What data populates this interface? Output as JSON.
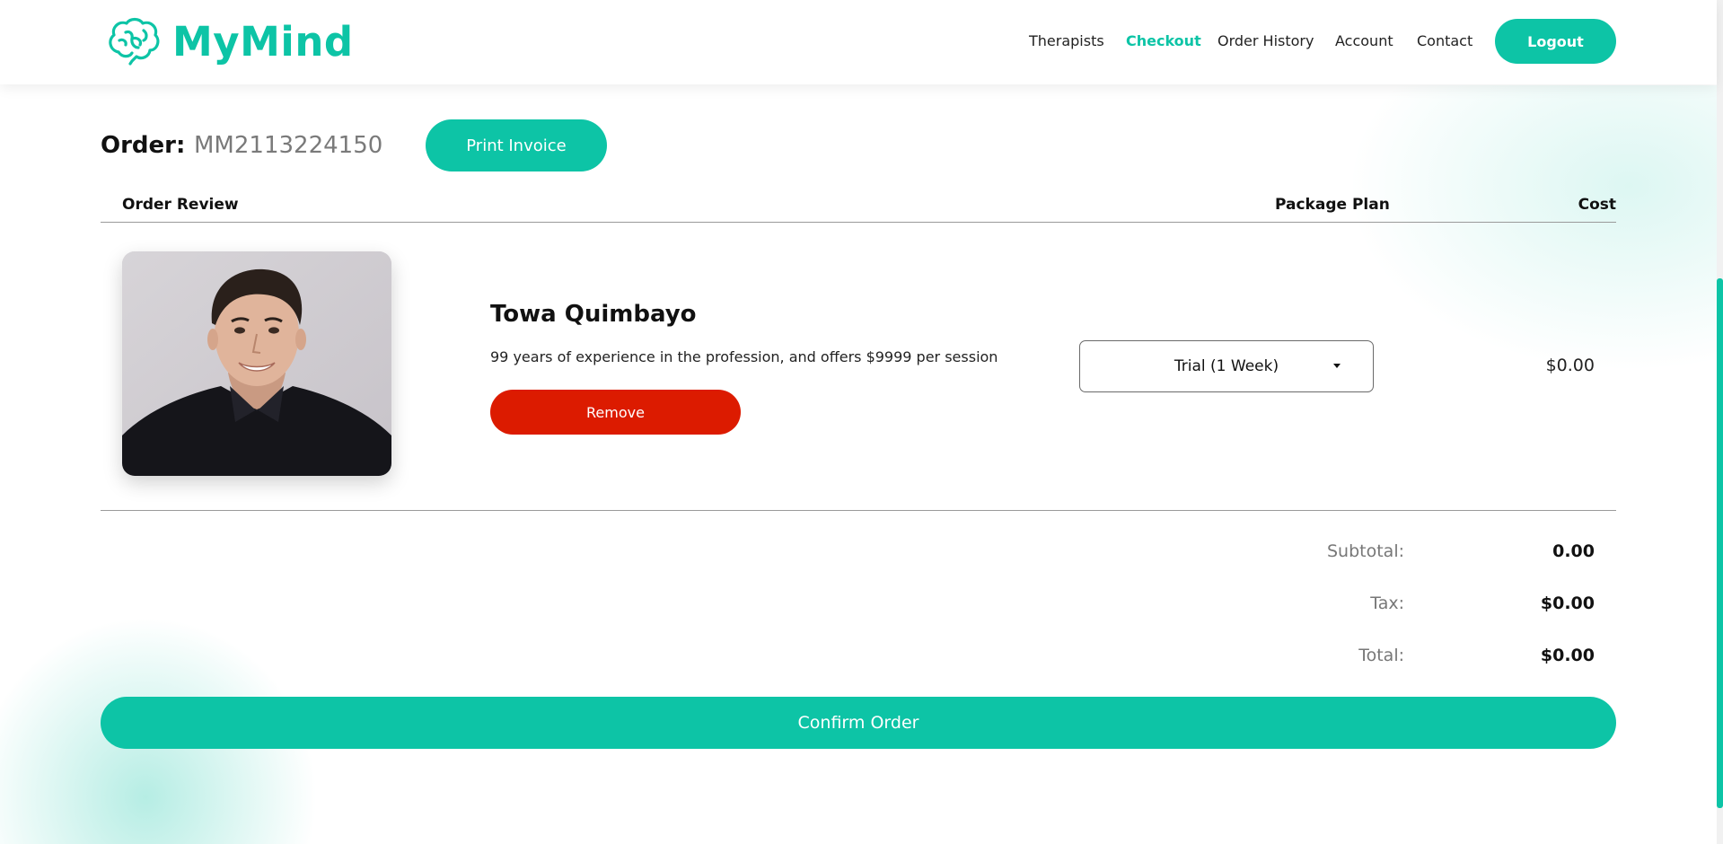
{
  "app": {
    "brand": "MyMind",
    "accent_color": "#0dc4a6",
    "danger_color": "#dc1b00"
  },
  "nav": {
    "items": [
      {
        "label": "Therapists",
        "active": false
      },
      {
        "label": "Checkout",
        "active": true
      },
      {
        "label": "Order History",
        "active": false
      },
      {
        "label": "Account",
        "active": false
      },
      {
        "label": "Contact",
        "active": false
      }
    ],
    "logout_label": "Logout"
  },
  "order": {
    "label": "Order:",
    "id": "MM2113224150",
    "print_label": "Print Invoice"
  },
  "table": {
    "headers": {
      "review": "Order Review",
      "plan": "Package Plan",
      "cost": "Cost"
    }
  },
  "item": {
    "photo_icon": "therapist-photo",
    "name": "Towa Quimbayo",
    "description": "99 years of experience in the profession, and offers $9999 per session",
    "remove_label": "Remove",
    "plan_selected": "Trial (1 Week)",
    "cost": "$0.00"
  },
  "totals": {
    "subtotal_label": "Subtotal:",
    "subtotal_value": "0.00",
    "tax_label": "Tax:",
    "tax_value": "$0.00",
    "total_label": "Total:",
    "total_value": "$0.00"
  },
  "confirm_label": "Confirm Order"
}
